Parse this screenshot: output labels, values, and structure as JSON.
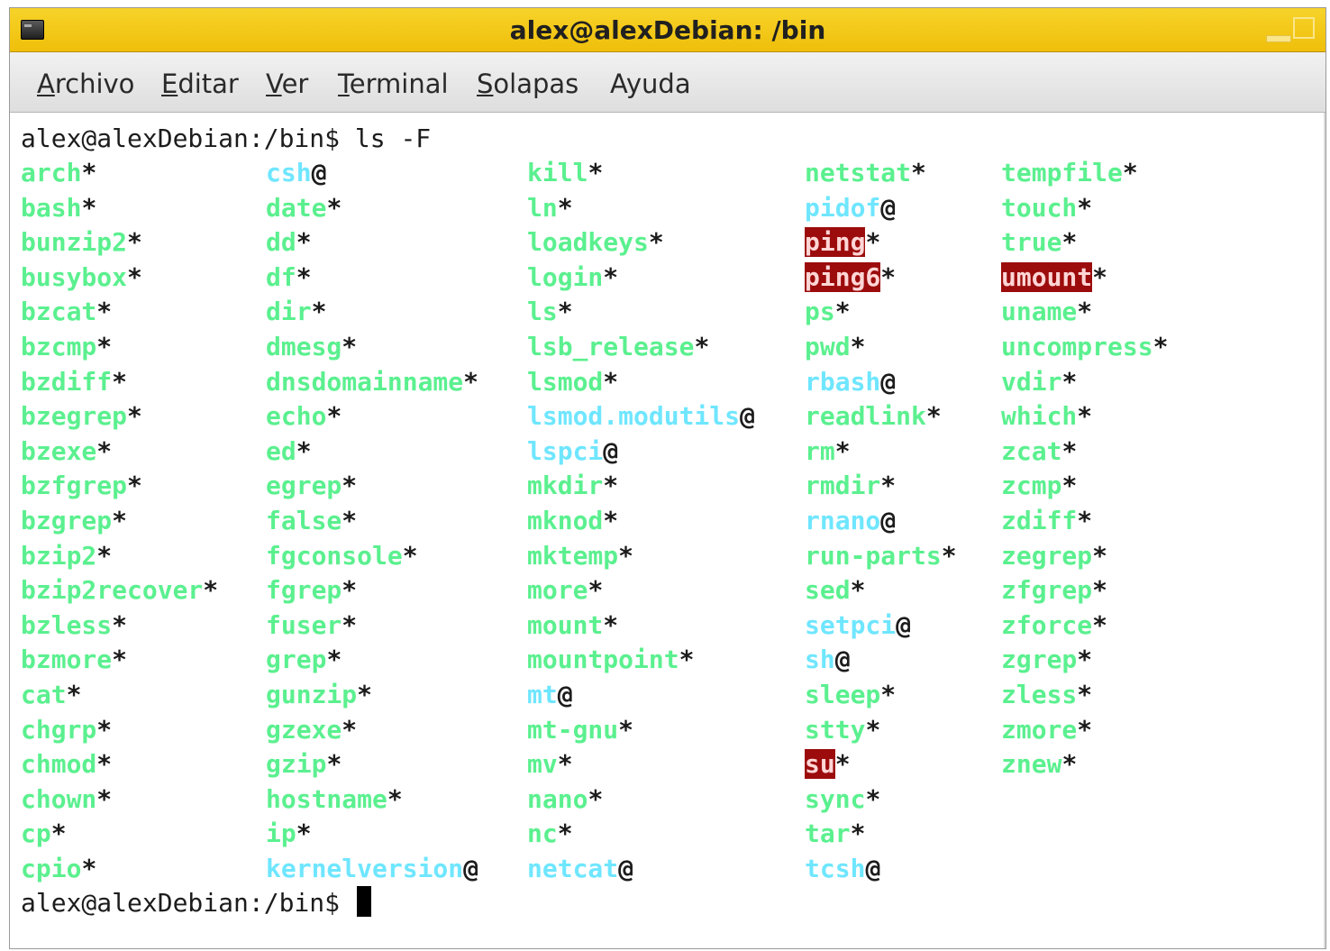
{
  "window": {
    "title": "alex@alexDebian: /bin"
  },
  "menu": [
    {
      "key": "archivo",
      "first": "A",
      "rest": "rchivo"
    },
    {
      "key": "editar",
      "first": "E",
      "rest": "ditar"
    },
    {
      "key": "ver",
      "first": "V",
      "rest": "er"
    },
    {
      "key": "terminal",
      "first": "T",
      "rest": "erminal"
    },
    {
      "key": "solapas",
      "first": "S",
      "rest": "olapas"
    },
    {
      "key": "ayuda",
      "first": "Ay",
      "rest": "uda"
    }
  ],
  "terminal": {
    "prompt": "alex@alexDebian:/bin$",
    "command": " ls -F",
    "prompt_end": "alex@alexDebian:/bin$ ",
    "colors": {
      "executable": "#5bf08f",
      "symlink": "#6fe6ff",
      "setuid_bg": "#9c0c0c"
    },
    "columns": [
      [
        [
          "arch",
          "*",
          "exec"
        ],
        [
          "bash",
          "*",
          "exec"
        ],
        [
          "bunzip2",
          "*",
          "exec"
        ],
        [
          "busybox",
          "*",
          "exec"
        ],
        [
          "bzcat",
          "*",
          "exec"
        ],
        [
          "bzcmp",
          "*",
          "exec"
        ],
        [
          "bzdiff",
          "*",
          "exec"
        ],
        [
          "bzegrep",
          "*",
          "exec"
        ],
        [
          "bzexe",
          "*",
          "exec"
        ],
        [
          "bzfgrep",
          "*",
          "exec"
        ],
        [
          "bzgrep",
          "*",
          "exec"
        ],
        [
          "bzip2",
          "*",
          "exec"
        ],
        [
          "bzip2recover",
          "*",
          "exec"
        ],
        [
          "bzless",
          "*",
          "exec"
        ],
        [
          "bzmore",
          "*",
          "exec"
        ],
        [
          "cat",
          "*",
          "exec"
        ],
        [
          "chgrp",
          "*",
          "exec"
        ],
        [
          "chmod",
          "*",
          "exec"
        ],
        [
          "chown",
          "*",
          "exec"
        ],
        [
          "cp",
          "*",
          "exec"
        ],
        [
          "cpio",
          "*",
          "exec"
        ]
      ],
      [
        [
          "csh",
          "@",
          "link"
        ],
        [
          "date",
          "*",
          "exec"
        ],
        [
          "dd",
          "*",
          "exec"
        ],
        [
          "df",
          "*",
          "exec"
        ],
        [
          "dir",
          "*",
          "exec"
        ],
        [
          "dmesg",
          "*",
          "exec"
        ],
        [
          "dnsdomainname",
          "*",
          "exec"
        ],
        [
          "echo",
          "*",
          "exec"
        ],
        [
          "ed",
          "*",
          "exec"
        ],
        [
          "egrep",
          "*",
          "exec"
        ],
        [
          "false",
          "*",
          "exec"
        ],
        [
          "fgconsole",
          "*",
          "exec"
        ],
        [
          "fgrep",
          "*",
          "exec"
        ],
        [
          "fuser",
          "*",
          "exec"
        ],
        [
          "grep",
          "*",
          "exec"
        ],
        [
          "gunzip",
          "*",
          "exec"
        ],
        [
          "gzexe",
          "*",
          "exec"
        ],
        [
          "gzip",
          "*",
          "exec"
        ],
        [
          "hostname",
          "*",
          "exec"
        ],
        [
          "ip",
          "*",
          "exec"
        ],
        [
          "kernelversion",
          "@",
          "link"
        ]
      ],
      [
        [
          "kill",
          "*",
          "exec"
        ],
        [
          "ln",
          "*",
          "exec"
        ],
        [
          "loadkeys",
          "*",
          "exec"
        ],
        [
          "login",
          "*",
          "exec"
        ],
        [
          "ls",
          "*",
          "exec"
        ],
        [
          "lsb_release",
          "*",
          "exec"
        ],
        [
          "lsmod",
          "*",
          "exec"
        ],
        [
          "lsmod.modutils",
          "@",
          "link"
        ],
        [
          "lspci",
          "@",
          "link"
        ],
        [
          "mkdir",
          "*",
          "exec"
        ],
        [
          "mknod",
          "*",
          "exec"
        ],
        [
          "mktemp",
          "*",
          "exec"
        ],
        [
          "more",
          "*",
          "exec"
        ],
        [
          "mount",
          "*",
          "exec"
        ],
        [
          "mountpoint",
          "*",
          "exec"
        ],
        [
          "mt",
          "@",
          "link"
        ],
        [
          "mt-gnu",
          "*",
          "exec"
        ],
        [
          "mv",
          "*",
          "exec"
        ],
        [
          "nano",
          "*",
          "exec"
        ],
        [
          "nc",
          "*",
          "exec"
        ],
        [
          "netcat",
          "@",
          "link"
        ]
      ],
      [
        [
          "netstat",
          "*",
          "exec"
        ],
        [
          "pidof",
          "@",
          "link"
        ],
        [
          "ping",
          "*",
          "setuid"
        ],
        [
          "ping6",
          "*",
          "setuid"
        ],
        [
          "ps",
          "*",
          "exec"
        ],
        [
          "pwd",
          "*",
          "exec"
        ],
        [
          "rbash",
          "@",
          "link"
        ],
        [
          "readlink",
          "*",
          "exec"
        ],
        [
          "rm",
          "*",
          "exec"
        ],
        [
          "rmdir",
          "*",
          "exec"
        ],
        [
          "rnano",
          "@",
          "link"
        ],
        [
          "run-parts",
          "*",
          "exec"
        ],
        [
          "sed",
          "*",
          "exec"
        ],
        [
          "setpci",
          "@",
          "link"
        ],
        [
          "sh",
          "@",
          "link"
        ],
        [
          "sleep",
          "*",
          "exec"
        ],
        [
          "stty",
          "*",
          "exec"
        ],
        [
          "su",
          "*",
          "setuid"
        ],
        [
          "sync",
          "*",
          "exec"
        ],
        [
          "tar",
          "*",
          "exec"
        ],
        [
          "tcsh",
          "@",
          "link"
        ]
      ],
      [
        [
          "tempfile",
          "*",
          "exec"
        ],
        [
          "touch",
          "*",
          "exec"
        ],
        [
          "true",
          "*",
          "exec"
        ],
        [
          "umount",
          "*",
          "setuid"
        ],
        [
          "uname",
          "*",
          "exec"
        ],
        [
          "uncompress",
          "*",
          "exec"
        ],
        [
          "vdir",
          "*",
          "exec"
        ],
        [
          "which",
          "*",
          "exec"
        ],
        [
          "zcat",
          "*",
          "exec"
        ],
        [
          "zcmp",
          "*",
          "exec"
        ],
        [
          "zdiff",
          "*",
          "exec"
        ],
        [
          "zegrep",
          "*",
          "exec"
        ],
        [
          "zfgrep",
          "*",
          "exec"
        ],
        [
          "zforce",
          "*",
          "exec"
        ],
        [
          "zgrep",
          "*",
          "exec"
        ],
        [
          "zless",
          "*",
          "exec"
        ],
        [
          "zmore",
          "*",
          "exec"
        ],
        [
          "znew",
          "*",
          "exec"
        ]
      ]
    ]
  }
}
